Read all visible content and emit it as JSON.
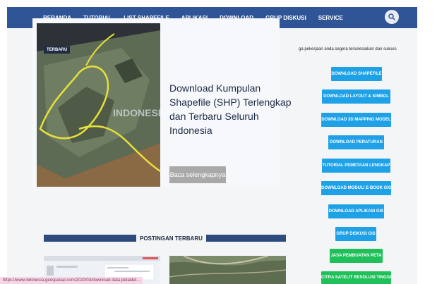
{
  "nav": {
    "items": [
      "BERANDA",
      "TUTORIAL",
      "LIST SHAPEFILE",
      "APLIKASI",
      "DOWNLOAD",
      "GRUP DISKUSI",
      "SERVICE"
    ],
    "search_icon": "search-icon",
    "color": "#2f5597"
  },
  "hero": {
    "tag": "TERBARU",
    "image_text": "INDONESIA GE",
    "title": "Download Kumpulan Shapefile (SHP) Terlengkap dan Terbaru Seluruh Indonesia",
    "read_more": "Baca selengkapnya"
  },
  "section": {
    "title": "POSTINGAN TERBARU"
  },
  "status_url": "https://www.indonesia-geospasial.com/2020/03/download-data-petaidel...",
  "sidebar": {
    "intro": "ga pekerjaan anda segera terselesaikan dan sukses",
    "buttons": [
      {
        "label": "DOWNLOAD SHAPEFILE",
        "color": "#1ea1e6"
      },
      {
        "label": "DOWNLOAD LAYOUT & SIMBOL",
        "color": "#1ea1e6"
      },
      {
        "label": "DOWNLOAD 3D MAPPING MODEL",
        "color": "#1ea1e6"
      },
      {
        "label": "DOWNLOAD PERATURAN",
        "color": "#1ea1e6"
      },
      {
        "label": "TUTORIAL PEMETAAN LENGKAP",
        "color": "#1ea1e6"
      },
      {
        "label": "DOWNLOAD MODUL/ E-BOOK GIS",
        "color": "#1ea1e6"
      },
      {
        "label": "DOWNLOAD APLIKASI GIS",
        "color": "#1ea1e6"
      },
      {
        "label": "GRUP DISKUSI GIS",
        "color": "#1ea1e6"
      },
      {
        "label": "JASA PEMBUATAN PETA",
        "color": "#1fc05a"
      },
      {
        "label": "CITRA SATELIT RESOLUSI TINGGI",
        "color": "#1fc05a"
      }
    ]
  }
}
